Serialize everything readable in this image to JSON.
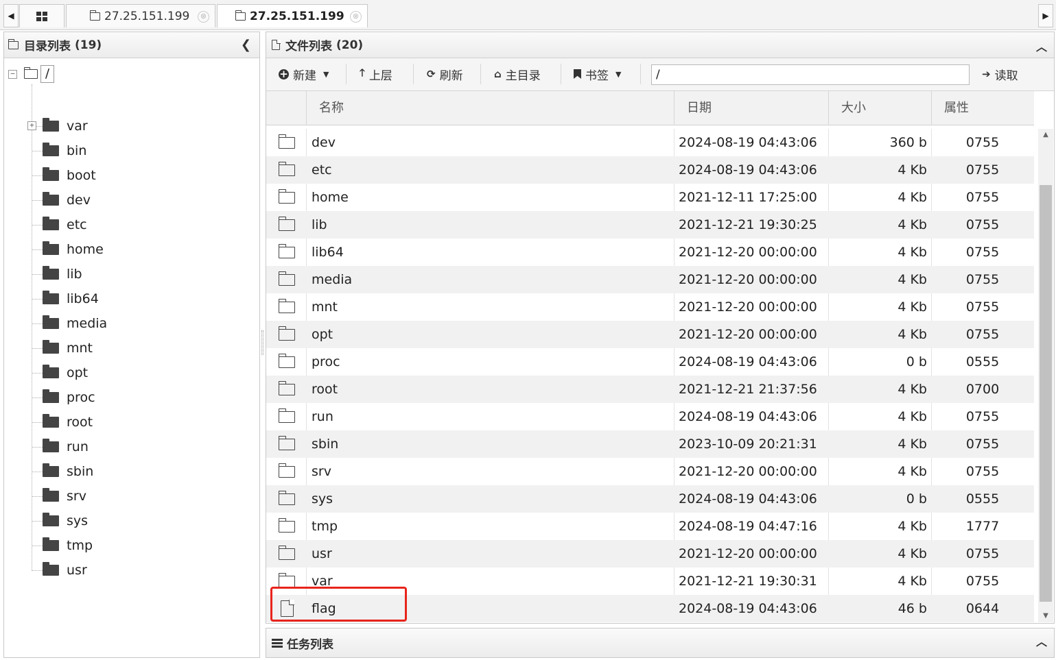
{
  "tabs": {
    "grid_icon": "grid-icon",
    "items": [
      {
        "label": "27.25.151.199",
        "active": false
      },
      {
        "label": "27.25.151.199",
        "active": true
      }
    ],
    "close_glyph": "⊗",
    "scroll_left": "◀",
    "scroll_right": "▶"
  },
  "directory_panel": {
    "title": "目录列表",
    "count": "(19)",
    "collapse_glyph": "❮",
    "root": {
      "label": "/",
      "expander": "−"
    },
    "items": [
      {
        "label": "var",
        "expander": "+"
      },
      {
        "label": "bin"
      },
      {
        "label": "boot"
      },
      {
        "label": "dev"
      },
      {
        "label": "etc"
      },
      {
        "label": "home"
      },
      {
        "label": "lib"
      },
      {
        "label": "lib64"
      },
      {
        "label": "media"
      },
      {
        "label": "mnt"
      },
      {
        "label": "opt"
      },
      {
        "label": "proc"
      },
      {
        "label": "root"
      },
      {
        "label": "run"
      },
      {
        "label": "sbin"
      },
      {
        "label": "srv"
      },
      {
        "label": "sys"
      },
      {
        "label": "tmp"
      },
      {
        "label": "usr"
      }
    ]
  },
  "file_panel": {
    "title": "文件列表",
    "count": "(20)",
    "collapse_glyph": "︿",
    "toolbar": {
      "new_label": "新建",
      "up_label": "上层",
      "refresh_label": "刷新",
      "home_label": "主目录",
      "bookmark_label": "书签",
      "path_value": "/",
      "read_label": "读取"
    },
    "columns": {
      "name": "名称",
      "date": "日期",
      "size": "大小",
      "attr": "属性"
    },
    "rows": [
      {
        "type": "folder",
        "name": "dev",
        "date": "2024-08-19 04:43:06",
        "size": "360 b",
        "attr": "0755"
      },
      {
        "type": "folder",
        "name": "etc",
        "date": "2024-08-19 04:43:06",
        "size": "4 Kb",
        "attr": "0755"
      },
      {
        "type": "folder",
        "name": "home",
        "date": "2021-12-11 17:25:00",
        "size": "4 Kb",
        "attr": "0755"
      },
      {
        "type": "folder",
        "name": "lib",
        "date": "2021-12-21 19:30:25",
        "size": "4 Kb",
        "attr": "0755"
      },
      {
        "type": "folder",
        "name": "lib64",
        "date": "2021-12-20 00:00:00",
        "size": "4 Kb",
        "attr": "0755"
      },
      {
        "type": "folder",
        "name": "media",
        "date": "2021-12-20 00:00:00",
        "size": "4 Kb",
        "attr": "0755"
      },
      {
        "type": "folder",
        "name": "mnt",
        "date": "2021-12-20 00:00:00",
        "size": "4 Kb",
        "attr": "0755"
      },
      {
        "type": "folder",
        "name": "opt",
        "date": "2021-12-20 00:00:00",
        "size": "4 Kb",
        "attr": "0755"
      },
      {
        "type": "folder",
        "name": "proc",
        "date": "2024-08-19 04:43:06",
        "size": "0 b",
        "attr": "0555"
      },
      {
        "type": "folder",
        "name": "root",
        "date": "2021-12-21 21:37:56",
        "size": "4 Kb",
        "attr": "0700"
      },
      {
        "type": "folder",
        "name": "run",
        "date": "2024-08-19 04:43:06",
        "size": "4 Kb",
        "attr": "0755"
      },
      {
        "type": "folder",
        "name": "sbin",
        "date": "2023-10-09 20:21:31",
        "size": "4 Kb",
        "attr": "0755"
      },
      {
        "type": "folder",
        "name": "srv",
        "date": "2021-12-20 00:00:00",
        "size": "4 Kb",
        "attr": "0755"
      },
      {
        "type": "folder",
        "name": "sys",
        "date": "2024-08-19 04:43:06",
        "size": "0 b",
        "attr": "0555"
      },
      {
        "type": "folder",
        "name": "tmp",
        "date": "2024-08-19 04:47:16",
        "size": "4 Kb",
        "attr": "1777"
      },
      {
        "type": "folder",
        "name": "usr",
        "date": "2021-12-20 00:00:00",
        "size": "4 Kb",
        "attr": "0755"
      },
      {
        "type": "folder",
        "name": "var",
        "date": "2021-12-21 19:30:31",
        "size": "4 Kb",
        "attr": "0755"
      },
      {
        "type": "file",
        "name": "flag",
        "date": "2024-08-19 04:43:06",
        "size": "46 b",
        "attr": "0644"
      }
    ],
    "highlight_color": "#e8241b"
  },
  "task_panel": {
    "title": "任务列表",
    "collapse_glyph": "︿"
  }
}
